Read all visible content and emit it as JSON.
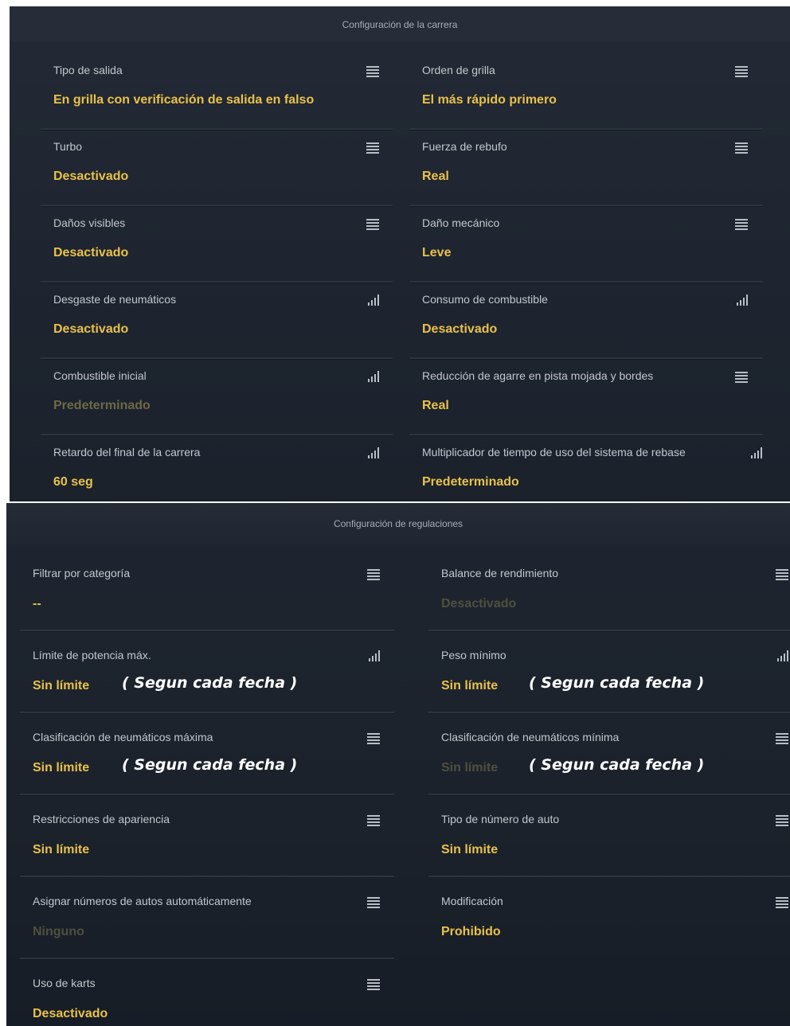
{
  "race": {
    "title": "Configuración de la carrera",
    "rows": [
      {
        "label": "Tipo de salida",
        "value": "En grilla con verificación de salida en falso",
        "icon": "menu-icon"
      },
      {
        "label": "Orden de grilla",
        "value": "El más rápido primero",
        "icon": "menu-icon"
      },
      {
        "label": "Turbo",
        "value": "Desactivado",
        "icon": "menu-icon"
      },
      {
        "label": "Fuerza de rebufo",
        "value": "Real",
        "icon": "menu-icon"
      },
      {
        "label": "Daños visibles",
        "value": "Desactivado",
        "icon": "menu-icon"
      },
      {
        "label": "Daño mecánico",
        "value": "Leve",
        "icon": "menu-icon"
      },
      {
        "label": "Desgaste de neumáticos",
        "value": "Desactivado",
        "icon": "bars-icon"
      },
      {
        "label": "Consumo de combustible",
        "value": "Desactivado",
        "icon": "bars-icon"
      },
      {
        "label": "Combustible inicial",
        "value": "Predeterminado",
        "icon": "bars-icon"
      },
      {
        "label": "Reducción de agarre en pista mojada y bordes",
        "value": "Real",
        "icon": "menu-icon"
      },
      {
        "label": "Retardo del final de la carrera",
        "value": "60 seg",
        "icon": "bars-icon"
      },
      {
        "label": "Multiplicador de tiempo de uso del sistema de rebase",
        "value": "Predeterminado",
        "icon": "bars-icon"
      }
    ]
  },
  "regulations": {
    "title": "Configuración de regulaciones",
    "rows": [
      {
        "label": "Filtrar por categoría",
        "value": "--",
        "icon": "menu-icon"
      },
      {
        "label": "Balance de rendimiento",
        "value": "Desactivado",
        "icon": "menu-icon"
      },
      {
        "label": "Límite de potencia máx.",
        "value": "Sin límite",
        "icon": "bars-icon"
      },
      {
        "label": "Peso mínimo",
        "value": "Sin límite",
        "icon": "bars-icon"
      },
      {
        "label": "Clasificación de neumáticos máxima",
        "value": "Sin límite",
        "icon": "menu-icon"
      },
      {
        "label": "Clasificación de neumáticos mínima",
        "value": "Sin límite",
        "icon": "menu-icon"
      },
      {
        "label": "Restricciones de apariencia",
        "value": "Sin límite",
        "icon": "menu-icon"
      },
      {
        "label": "Tipo de número de auto",
        "value": "Sin límite",
        "icon": "menu-icon"
      },
      {
        "label": "Asignar números de autos automáticamente",
        "value": "Ninguno",
        "icon": "menu-icon"
      },
      {
        "label": "Modificación",
        "value": "Prohibido",
        "icon": "menu-icon"
      },
      {
        "label": "Uso de karts",
        "value": "Desactivado",
        "icon": "menu-icon"
      }
    ]
  },
  "annotation": {
    "text": "( Segun cada fecha )"
  },
  "colors": {
    "value": "#e9c14a",
    "value_disabled": "#6e6845",
    "label": "#c3c7cd",
    "background": "#1e2530"
  }
}
